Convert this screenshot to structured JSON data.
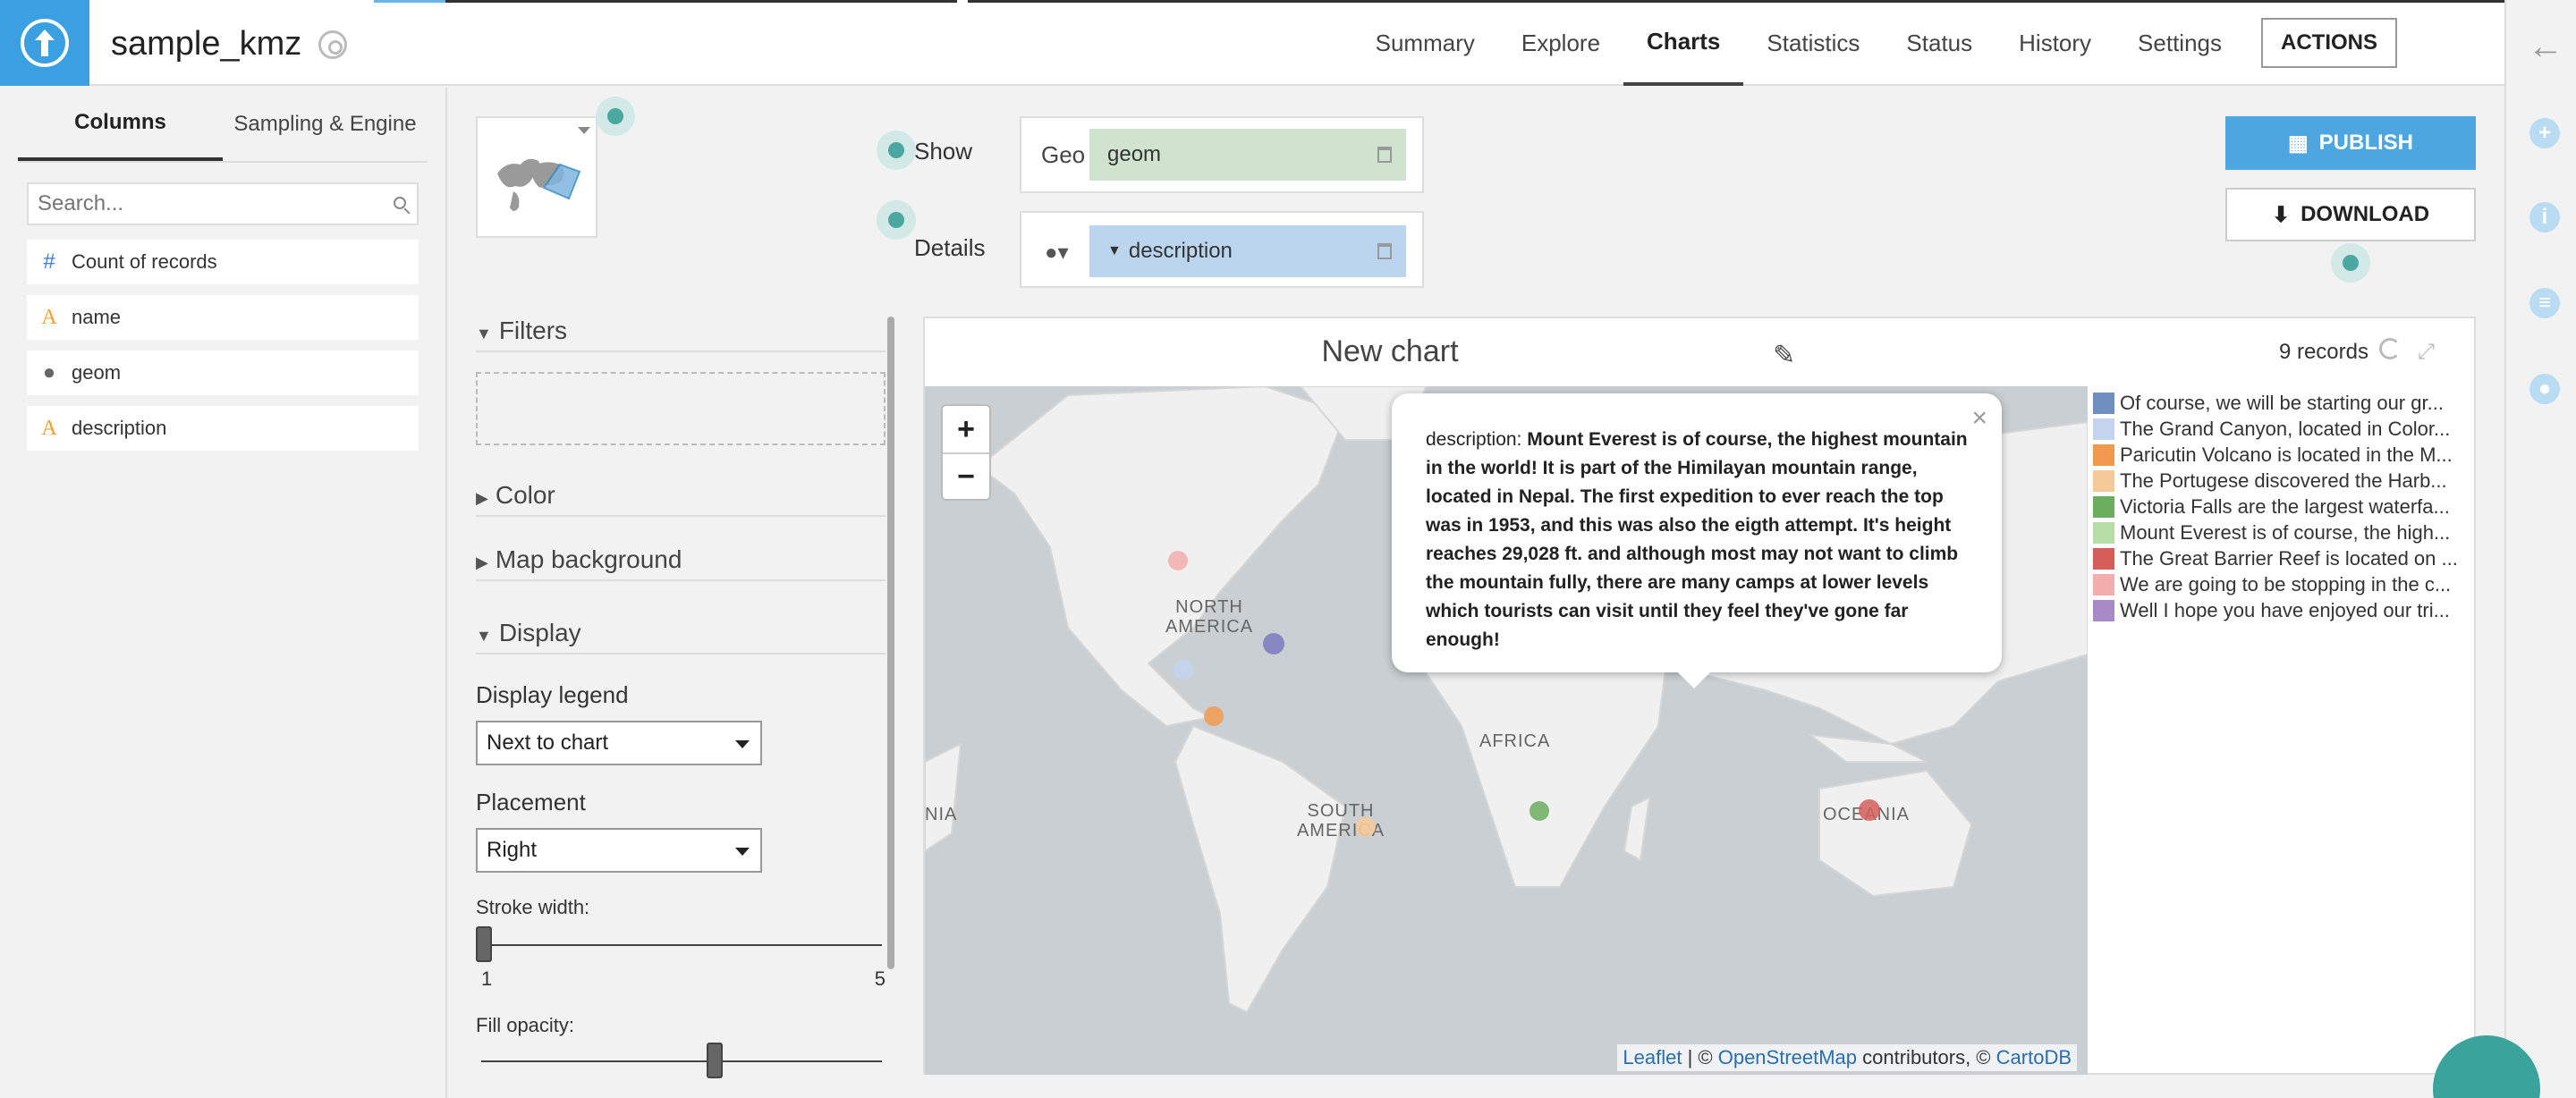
{
  "app": {
    "dataset_name": "sample_kmz"
  },
  "nav": {
    "tabs": [
      "Summary",
      "Explore",
      "Charts",
      "Statistics",
      "Status",
      "History",
      "Settings"
    ],
    "active_tab": "Charts",
    "actions_label": "ACTIONS"
  },
  "left_panel": {
    "tabs": [
      "Columns",
      "Sampling & Engine"
    ],
    "search_placeholder": "Search...",
    "columns": [
      {
        "type": "numeric",
        "icon": "#",
        "name": "Count of records"
      },
      {
        "type": "alpha",
        "icon": "A",
        "name": "name"
      },
      {
        "type": "geo",
        "icon": "●",
        "name": "geom"
      },
      {
        "type": "alpha",
        "icon": "A",
        "name": "description"
      }
    ]
  },
  "config": {
    "show_label": "Show",
    "details_label": "Details",
    "geo_label": "Geo",
    "geo_value": "geom",
    "details_value": "description",
    "publish_label": "PUBLISH",
    "download_label": "DOWNLOAD"
  },
  "options": {
    "filters_label": "Filters",
    "color_label": "Color",
    "map_background_label": "Map background",
    "display_label": "Display",
    "display_legend_label": "Display legend",
    "display_legend_value": "Next to chart",
    "placement_label": "Placement",
    "placement_value": "Right",
    "stroke_width_label": "Stroke width:",
    "stroke_min": "1",
    "stroke_max": "5",
    "stroke_value": 1,
    "fill_opacity_label": "Fill opacity:",
    "fill_opacity_value": 0.6
  },
  "chart": {
    "title": "New chart",
    "records": "9 records",
    "map_labels": [
      "NORTH AMERICA",
      "AFRICA",
      "SOUTH AMERICA",
      "OCEANIA",
      "NIA"
    ],
    "tooltip_key": "description:",
    "tooltip_value": "Mount Everest is of course, the highest mountain in the world! It is part of the Himilayan mountain range, located in Nepal. The first expedition to ever reach the top was in 1953, and this was also the eigth attempt. It's height reaches 29,028 ft. and although most may not want to climb the mountain fully, there are many camps at lower levels which tourists can visit until they feel they've gone far enough!",
    "attribution": {
      "leaflet": "Leaflet",
      "sep1": " | © ",
      "osm": "OpenStreetMap",
      "mid": " contributors, © ",
      "carto": "CartoDB"
    },
    "legend": [
      {
        "label": "Of course, we will be starting our gr...",
        "color": "#6f8fc1"
      },
      {
        "label": "The Grand Canyon, located in Color...",
        "color": "#c4d4ee"
      },
      {
        "label": "Paricutin Volcano is located in the M...",
        "color": "#f19a4f"
      },
      {
        "label": "The Portugese discovered the Harb...",
        "color": "#f6c999"
      },
      {
        "label": "Victoria Falls are the largest waterfa...",
        "color": "#6bae5f"
      },
      {
        "label": "Mount Everest is of course, the high...",
        "color": "#b6dda6"
      },
      {
        "label": "The Great Barrier Reef is located on ...",
        "color": "#d65e5a"
      },
      {
        "label": "We are going to be stopping in the c...",
        "color": "#f3adad"
      },
      {
        "label": "Well I hope you have enjoyed our tri...",
        "color": "#a98ac9"
      }
    ]
  }
}
